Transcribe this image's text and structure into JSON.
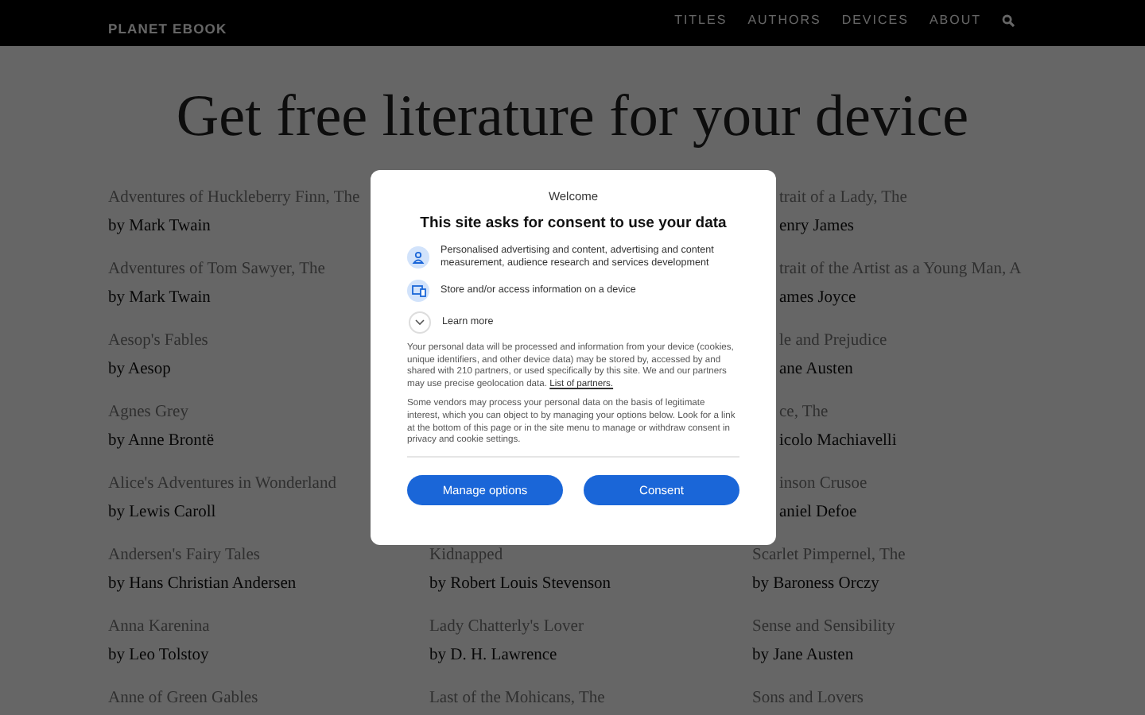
{
  "header": {
    "logo": "PLANET EBOOK",
    "nav": [
      "TITLES",
      "AUTHORS",
      "DEVICES",
      "ABOUT"
    ]
  },
  "heading": "Get free literature for your device",
  "columns": [
    {
      "items": [
        {
          "title": "Adventures of Huckleberry Finn, The",
          "author": "by Mark Twain",
          "clipped": false
        },
        {
          "title": "Adventures of Tom Sawyer, The",
          "author": "by Mark Twain",
          "clipped": false
        },
        {
          "title": "Aesop's Fables",
          "author": "by Aesop",
          "clipped": false
        },
        {
          "title": "Agnes Grey",
          "author": "by Anne Brontë",
          "clipped": false
        },
        {
          "title": "Alice's Adventures in Wonderland",
          "author": "by Lewis Caroll",
          "clipped": false
        },
        {
          "title": "Andersen's Fairy Tales",
          "author": "by Hans Christian Andersen",
          "clipped": false
        },
        {
          "title": "Anna Karenina",
          "author": "by Leo Tolstoy",
          "clipped": false
        },
        {
          "title": "Anne of Green Gables",
          "clipped": false
        }
      ]
    },
    {
      "items": [
        {
          "title": "Kidnapped",
          "author": "by Robert Louis Stevenson",
          "clipped": false
        },
        {
          "title": "Lady Chatterly's Lover",
          "author": "by D. H. Lawrence",
          "clipped": false
        },
        {
          "title": "Last of the Mohicans, The",
          "clipped": false
        }
      ]
    },
    {
      "items": [
        {
          "title": "trait of a Lady, The",
          "author": "enry James",
          "clipped": true
        },
        {
          "title": "trait of the Artist as a Young Man, A",
          "author": "ames Joyce",
          "clipped": true
        },
        {
          "title": "le and Prejudice",
          "author": "ane Austen",
          "clipped": true
        },
        {
          "title": "ce, The",
          "author": "icolo Machiavelli",
          "clipped": true
        },
        {
          "title": "inson Crusoe",
          "author": "aniel Defoe",
          "clipped": true
        },
        {
          "title": "Scarlet Pimpernel, The",
          "author": "by Baroness Orczy",
          "clipped": false
        },
        {
          "title": "Sense and Sensibility",
          "author": "by Jane Austen",
          "clipped": false
        },
        {
          "title": "Sons and Lovers",
          "clipped": false
        }
      ]
    }
  ],
  "dialog": {
    "welcome": "Welcome",
    "title": "This site asks for consent to use your data",
    "purposes": [
      {
        "kind": "person",
        "text": "Personalised advertising and content, advertising and content measurement, audience research and services development"
      },
      {
        "kind": "device",
        "text": "Store and/or access information on a device"
      }
    ],
    "learn_more": "Learn more",
    "paragraph_1": "Your personal data will be processed and information from your device (cookies, unique identifiers, and other device data) may be stored by, accessed by and shared with 210 partners, or used specifically by this site. We and our partners may use precise geolocation data.",
    "partners_link": "List of partners.",
    "paragraph_2": "Some vendors may process your personal data on the basis of legitimate interest, which you can object to by managing your options below. Look for a link at the bottom of this page or in the site menu to manage or withdraw consent in privacy and cookie settings.",
    "buttons": [
      "Manage options",
      "Consent"
    ]
  }
}
